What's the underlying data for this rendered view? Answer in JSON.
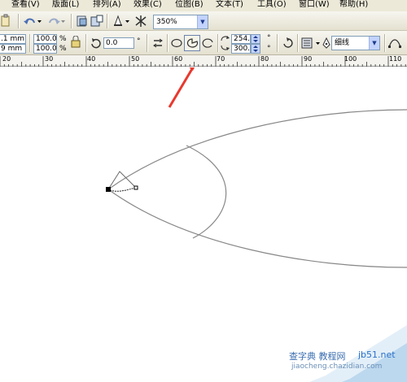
{
  "menubar": {
    "items": [
      "查看(V)",
      "版面(L)",
      "排列(A)",
      "效果(C)",
      "位图(B)",
      "文本(T)",
      "工具(O)",
      "窗口(W)",
      "帮助(H)"
    ]
  },
  "toolbar": {
    "zoom_level": "350%"
  },
  "propbar": {
    "width_value": ".1 mm",
    "height_value": "9 mm",
    "scale_x": "100.0",
    "scale_y": "100.0",
    "percent_symbol": "%",
    "rotation_value": "0.0",
    "degree_symbol": "°",
    "start_angle": "254.0",
    "end_angle": "300.0",
    "outline_width": "细线"
  },
  "ruler": {
    "labels": [
      "20",
      "30",
      "40",
      "50",
      "60",
      "70",
      "80",
      "90",
      "100",
      "110"
    ]
  },
  "watermark": {
    "site_cn": "查字典 教程网",
    "site_short": "jb51.net",
    "site_url": "jiaocheng.chazidian.com"
  },
  "colors": {
    "menu_bg": "#ece9d8",
    "arrow_red": "#e8392e",
    "shape_stroke": "#808080",
    "watermark_blue": "#2a72c8"
  }
}
